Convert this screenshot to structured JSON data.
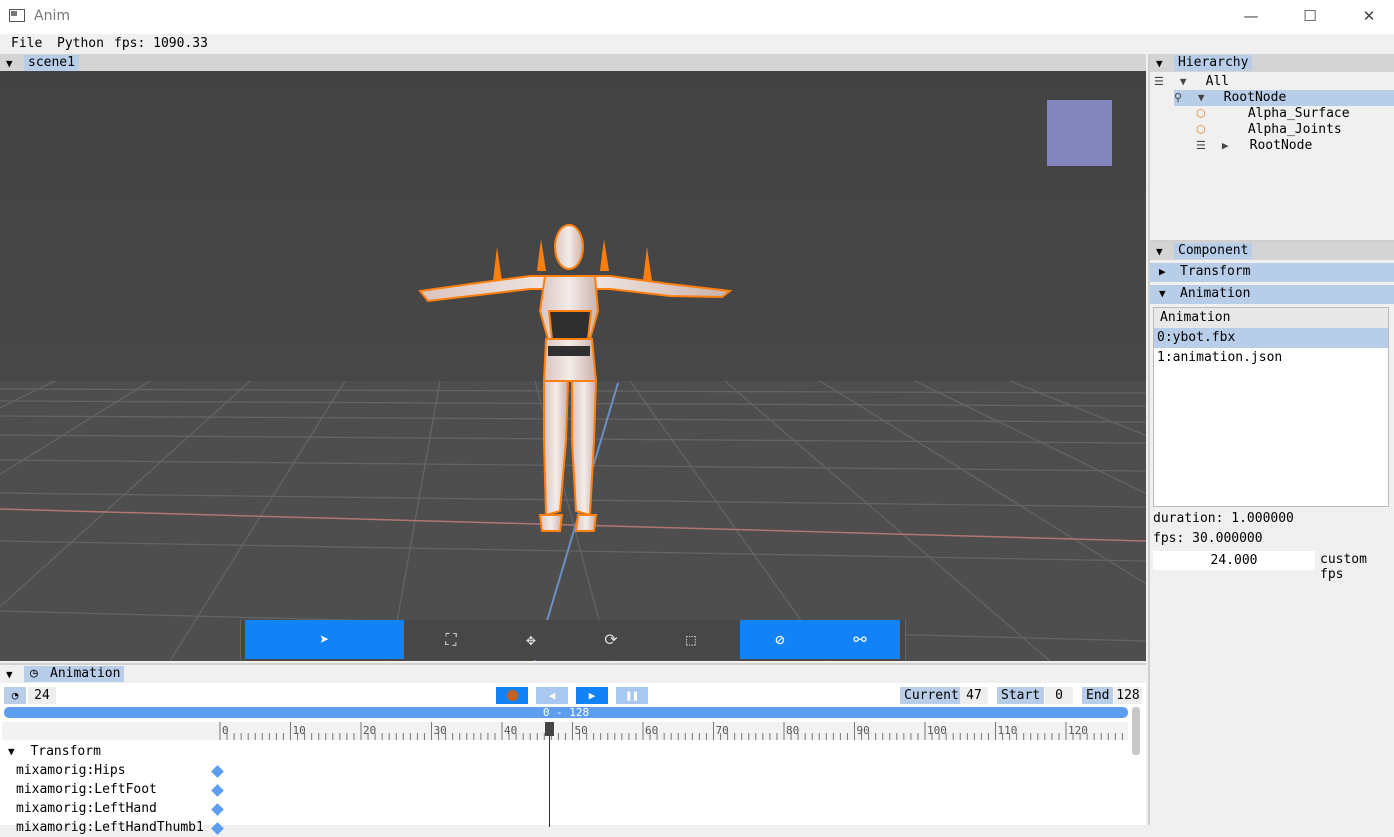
{
  "window": {
    "title": "Anim",
    "minimize": "—",
    "maximize": "☐",
    "close": "✕"
  },
  "menu": {
    "file": "File",
    "python": "Python",
    "fps": "fps: 1090.33"
  },
  "viewport": {
    "tab": "scene1"
  },
  "gizmo_toolbar": {
    "icons": [
      "select-arrow-icon",
      "frame-icon",
      "move-icon",
      "rotate-icon",
      "rect-select-icon",
      "hide-icon",
      "bone-icon"
    ]
  },
  "hierarchy": {
    "tab": "Hierarchy",
    "items": [
      {
        "label": "All"
      },
      {
        "label": "RootNode"
      },
      {
        "label": "Alpha_Surface"
      },
      {
        "label": "Alpha_Joints"
      },
      {
        "label": "RootNode"
      }
    ]
  },
  "component": {
    "tab": "Component",
    "transform": "Transform",
    "animation": "Animation",
    "list_header": "Animation",
    "list": [
      "0:ybot.fbx",
      "1:animation.json"
    ],
    "duration": "duration: 1.000000",
    "fps": "fps: 30.000000",
    "custom_fps_value": "24.000",
    "custom_fps_label": "custom fps"
  },
  "animation_panel": {
    "tab": "Animation",
    "speed": "24",
    "current_label": "Current",
    "current": "47",
    "start_label": "Start",
    "start": "0",
    "end_label": "End",
    "end": "128",
    "range": "0 - 128",
    "ruler_labels": [
      "0",
      "10",
      "20",
      "30",
      "40",
      "50",
      "60",
      "70",
      "80",
      "90",
      "100",
      "110",
      "120"
    ],
    "transform_group": "Transform",
    "tracks": [
      "mixamorig:Hips",
      "mixamorig:LeftFoot",
      "mixamorig:LeftHand",
      "mixamorig:LeftHandThumb1"
    ]
  },
  "colors": {
    "accent": "#1183f7",
    "highlight": "#b7cde8",
    "outline": "#ff7f0e"
  }
}
